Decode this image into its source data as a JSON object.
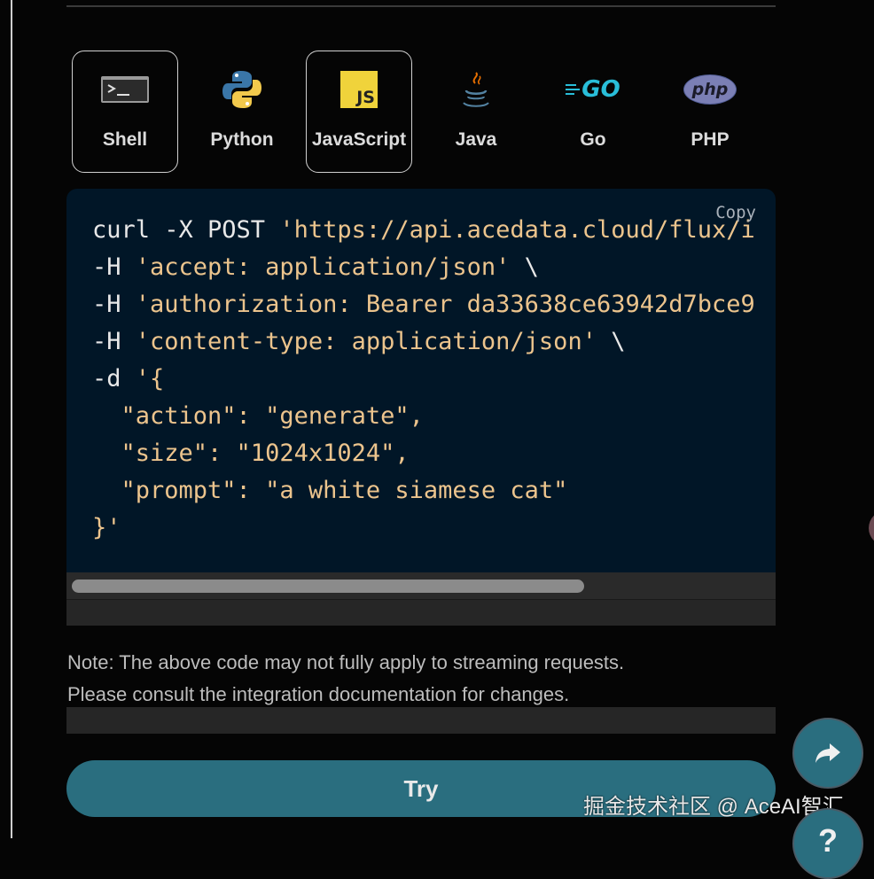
{
  "language_tabs": [
    {
      "label": "Shell",
      "icon": "terminal-icon",
      "selected": true
    },
    {
      "label": "Python",
      "icon": "python-icon",
      "selected": false
    },
    {
      "label": "JavaScript",
      "icon": "javascript-icon",
      "selected": true
    },
    {
      "label": "Java",
      "icon": "java-icon",
      "selected": false
    },
    {
      "label": "Go",
      "icon": "go-icon",
      "selected": false
    },
    {
      "label": "PHP",
      "icon": "php-icon",
      "selected": false
    }
  ],
  "js_icon_text": "JS",
  "go_icon_text": "GO",
  "php_icon_text": "php",
  "code_block": {
    "copy_label": "Copy",
    "lines": [
      {
        "p1": "curl -X POST ",
        "s1": "'https://api.acedata.cloud/flux/i"
      },
      {
        "p1": "-H ",
        "s1": "'accept: application/json'",
        "p2": " \\"
      },
      {
        "p1": "-H ",
        "s1": "'authorization: Bearer da33638ce63942d7bce9"
      },
      {
        "p1": "-H ",
        "s1": "'content-type: application/json'",
        "p2": " \\"
      },
      {
        "p1": "-d ",
        "s1": "'{"
      },
      {
        "s1": "  \"action\": \"generate\","
      },
      {
        "s1": "  \"size\": \"1024x1024\","
      },
      {
        "s1": "  \"prompt\": \"a white siamese cat\""
      },
      {
        "s1": "}'"
      }
    ]
  },
  "horizontal_scroll_fraction": 0.72,
  "note": {
    "line1": "Note: The above code may not fully apply to streaming requests.",
    "line2": "Please consult the integration documentation for changes."
  },
  "try_button_label": "Try",
  "share_button_icon": "share-icon",
  "help_button": {
    "icon": "help-icon",
    "label": "?"
  },
  "watermark": "掘金技术社区 @ AceAI智汇",
  "colors": {
    "accent": "#2a6e7f",
    "code_background": "#011627",
    "code_string": "#ecc48d",
    "page_background": "#050505"
  }
}
